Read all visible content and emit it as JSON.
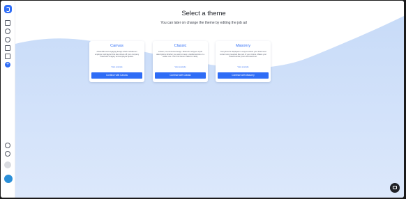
{
  "page": {
    "title": "Select a theme",
    "subtitle": "You can later on change the theme by editing the job ad"
  },
  "sidebar": {
    "logo": "logo-icon",
    "items": [
      {
        "icon": "building-icon"
      },
      {
        "icon": "user-icon"
      },
      {
        "icon": "check-circle-icon"
      },
      {
        "icon": "image-icon"
      },
      {
        "icon": "calendar-icon"
      },
      {
        "icon": "plus-circle-icon",
        "active": true
      }
    ],
    "bottom": [
      {
        "icon": "refresh-icon"
      },
      {
        "icon": "chat-search-icon"
      }
    ]
  },
  "themes": [
    {
      "name": "Canvas",
      "description": "A beautiful and engaging design which includes an employer card layout that also shows off your company brand with imagery and employee quotes.",
      "link": "View example",
      "button": "Continue with Canvas"
    },
    {
      "name": "Classic",
      "description": "A clean, no-nonsense design. Works for all types of job descriptions whether you want to keep a traditional look or a bolder one. Your first theme made for clarity.",
      "link": "View example",
      "button": "Continue with Classic"
    },
    {
      "name": "Masonry",
      "description": "Your job ad is displayed in a layout where your brand and content are presented like part of your culture. Makes your brand feel like yours and stand out.",
      "link": "View example",
      "button": "Continue with Masonry"
    }
  ],
  "colors": {
    "accent": "#2f6df6",
    "background_top": "#ffffff",
    "background_wave": "#c9dcf8"
  }
}
